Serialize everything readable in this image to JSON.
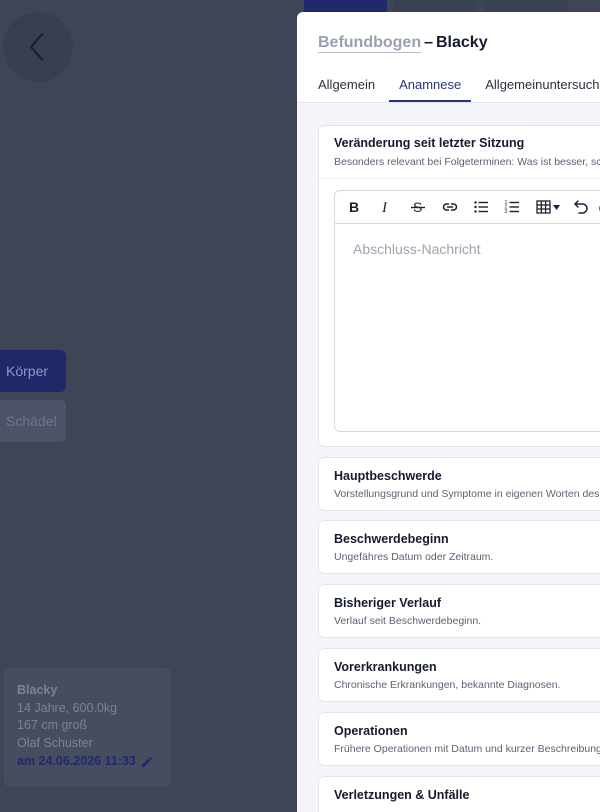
{
  "background": {
    "body_buttons": [
      {
        "label": "Körper"
      },
      {
        "label": "Schädel"
      }
    ],
    "patient_card": {
      "name": "Blacky",
      "age_weight": "14 Jahre, 600.0kg",
      "height": "167 cm groß",
      "owner": "Olaf Schuster",
      "appointment": "am 24.06.2026 11:33"
    }
  },
  "panel": {
    "title_link": "Befundbogen",
    "title_separator": "–",
    "title_name": "Blacky",
    "tabs": [
      {
        "label": "Allgemein"
      },
      {
        "label": "Anamnese"
      },
      {
        "label": "Allgemeinuntersuchung"
      }
    ],
    "active_tab": "Anamnese"
  },
  "sections": [
    {
      "title": "Veränderung seit letzter Sitzung",
      "subtitle": "Besonders relevant bei Folgeterminen: Was ist besser, schlechter oder gleich geblieben?"
    },
    {
      "title": "Hauptbeschwerde",
      "subtitle": "Vorstellungsgrund und Symptome in eigenen Worten des Besitzers."
    },
    {
      "title": "Beschwerdebeginn",
      "subtitle": "Ungefähres Datum oder Zeitraum."
    },
    {
      "title": "Bisheriger Verlauf",
      "subtitle": "Verlauf seit Beschwerdebeginn."
    },
    {
      "title": "Vorerkrankungen",
      "subtitle": "Chronische Erkrankungen, bekannte Diagnosen."
    },
    {
      "title": "Operationen",
      "subtitle": "Frühere Operationen mit Datum und kurzer Beschreibung."
    },
    {
      "title": "Verletzungen & Unfälle",
      "subtitle": ""
    }
  ],
  "editor": {
    "placeholder": "Abschluss-Nachricht",
    "toolbar": [
      "bold-icon",
      "italic-icon",
      "strikethrough-icon",
      "link-icon",
      "bullet-list-icon",
      "numbered-list-icon",
      "table-icon",
      "undo-icon"
    ]
  },
  "colors": {
    "accent": "#28337c",
    "backdrop": "#3f4556",
    "panel_bg": "#ffffff",
    "content_bg": "#f4f5f8"
  }
}
